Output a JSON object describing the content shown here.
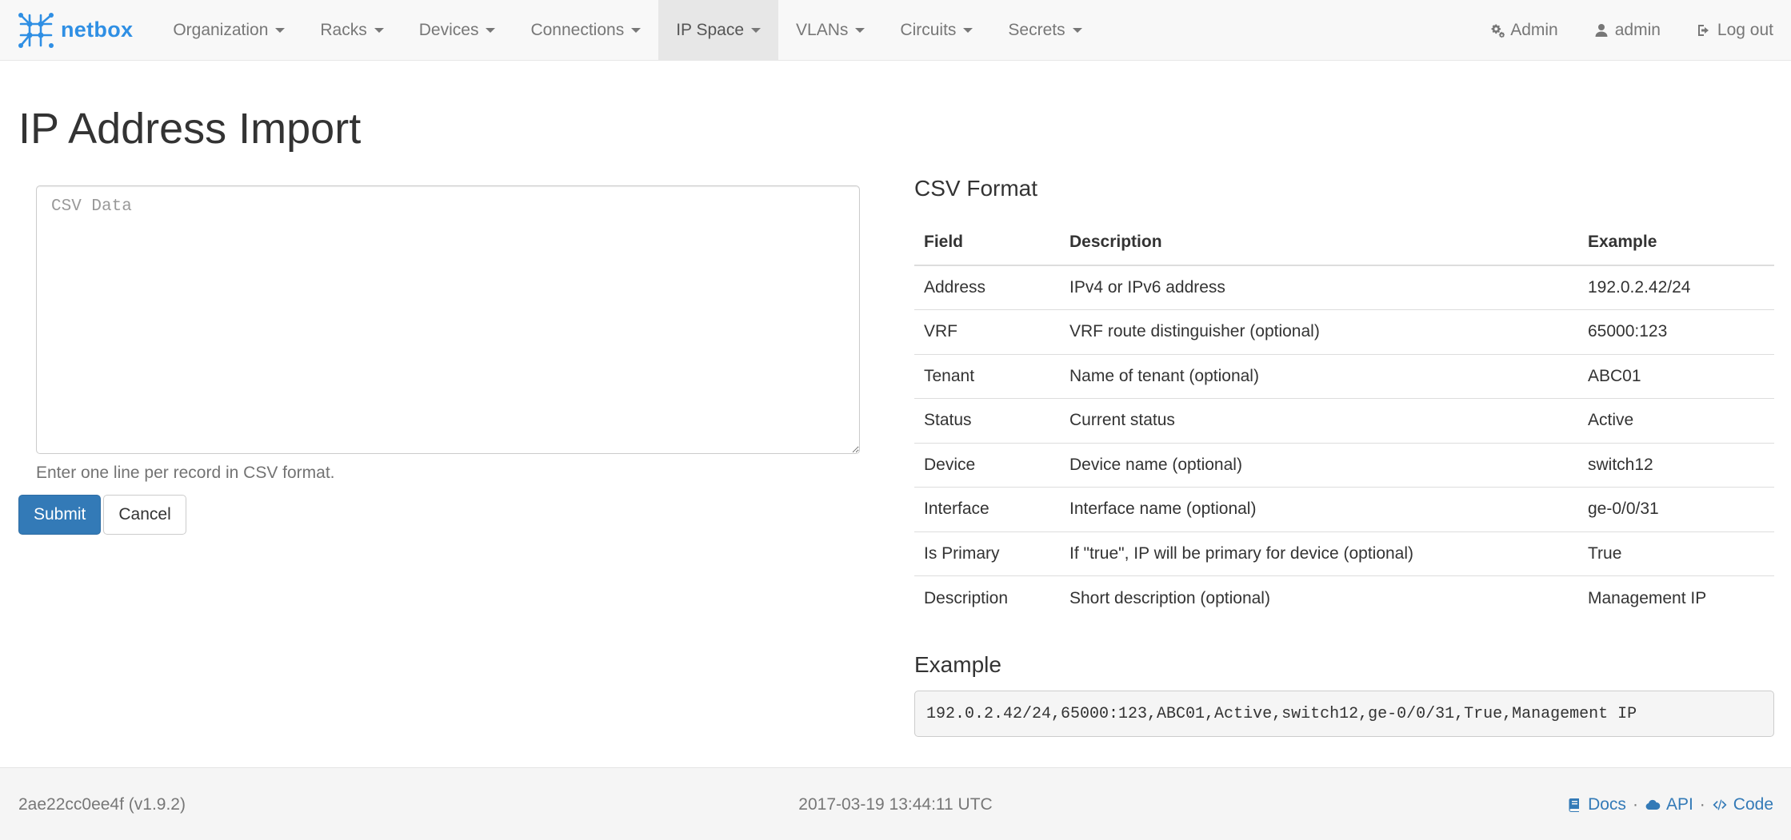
{
  "brand": {
    "name": "netbox",
    "icon": "netbox-logo-icon"
  },
  "nav": {
    "items": [
      {
        "label": "Organization",
        "active": false
      },
      {
        "label": "Racks",
        "active": false
      },
      {
        "label": "Devices",
        "active": false
      },
      {
        "label": "Connections",
        "active": false
      },
      {
        "label": "IP Space",
        "active": true
      },
      {
        "label": "VLANs",
        "active": false
      },
      {
        "label": "Circuits",
        "active": false
      },
      {
        "label": "Secrets",
        "active": false
      }
    ],
    "right": [
      {
        "label": "Admin",
        "icon": "gears-icon"
      },
      {
        "label": "admin",
        "icon": "user-icon"
      },
      {
        "label": "Log out",
        "icon": "sign-out-icon"
      }
    ]
  },
  "page": {
    "title": "IP Address Import"
  },
  "form": {
    "csv_placeholder": "CSV Data",
    "csv_value": "",
    "help": "Enter one line per record in CSV format.",
    "submit_label": "Submit",
    "cancel_label": "Cancel"
  },
  "csv_format": {
    "title": "CSV Format",
    "headers": {
      "field": "Field",
      "description": "Description",
      "example": "Example"
    },
    "rows": [
      {
        "field": "Address",
        "description": "IPv4 or IPv6 address",
        "example": "192.0.2.42/24"
      },
      {
        "field": "VRF",
        "description": "VRF route distinguisher (optional)",
        "example": "65000:123"
      },
      {
        "field": "Tenant",
        "description": "Name of tenant (optional)",
        "example": "ABC01"
      },
      {
        "field": "Status",
        "description": "Current status",
        "example": "Active"
      },
      {
        "field": "Device",
        "description": "Device name (optional)",
        "example": "switch12"
      },
      {
        "field": "Interface",
        "description": "Interface name (optional)",
        "example": "ge-0/0/31"
      },
      {
        "field": "Is Primary",
        "description": "If \"true\", IP will be primary for device (optional)",
        "example": "True"
      },
      {
        "field": "Description",
        "description": "Short description (optional)",
        "example": "Management IP"
      }
    ]
  },
  "example": {
    "title": "Example",
    "code": "192.0.2.42/24,65000:123,ABC01,Active,switch12,ge-0/0/31,True,Management IP"
  },
  "footer": {
    "version": "2ae22cc0ee4f (v1.9.2)",
    "timestamp": "2017-03-19 13:44:11 UTC",
    "links": [
      {
        "label": "Docs",
        "icon": "book-icon"
      },
      {
        "label": "API",
        "icon": "cloud-icon"
      },
      {
        "label": "Code",
        "icon": "code-icon"
      }
    ],
    "separator": "·"
  },
  "colors": {
    "brand": "#2f8fe4",
    "primary": "#337ab7",
    "navbar_bg": "#f8f8f8",
    "nav_active_bg": "#e7e7e7",
    "footer_bg": "#f5f5f5"
  }
}
